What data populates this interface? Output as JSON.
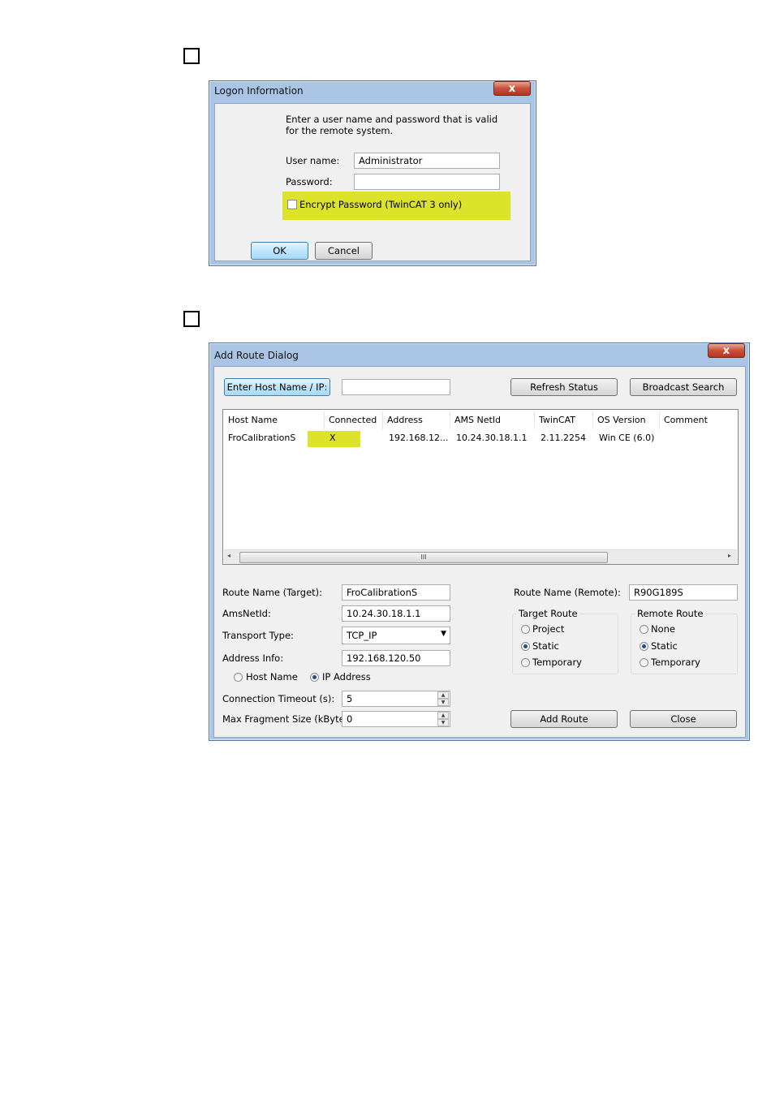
{
  "logon": {
    "title": "Logon Information",
    "close_glyph": "x",
    "instruction": "Enter a user name and password that is valid for the remote system.",
    "username_label": "User name:",
    "username_value": "Administrator",
    "password_label": "Password:",
    "password_value": "",
    "encrypt_label": "Encrypt Password (TwinCAT 3 only)",
    "ok_label": "OK",
    "cancel_label": "Cancel"
  },
  "route": {
    "title": "Add Route Dialog",
    "close_glyph": "x",
    "enter_host_label": "Enter Host Name / IP:",
    "host_input_value": "",
    "refresh_label": "Refresh Status",
    "broadcast_label": "Broadcast Search",
    "columns": [
      "Host Name",
      "Connected",
      "Address",
      "AMS NetId",
      "TwinCAT",
      "OS Version",
      "Comment"
    ],
    "rows": [
      [
        "FroCalibrationS",
        "X",
        "192.168.12...",
        "10.24.30.18.1.1",
        "2.11.2254",
        "Win CE (6.0)",
        ""
      ]
    ],
    "scroll_thumb_glyph": "III",
    "route_name_target_label": "Route Name (Target):",
    "route_name_target_value": "FroCalibrationS",
    "amsnetid_label": "AmsNetId:",
    "amsnetid_value": "10.24.30.18.1.1",
    "transport_label": "Transport Type:",
    "transport_value": "TCP_IP",
    "address_info_label": "Address Info:",
    "address_info_value": "192.168.120.50",
    "host_name_radio": "Host Name",
    "ip_address_radio": "IP Address",
    "timeout_label": "Connection Timeout (s):",
    "timeout_value": "5",
    "fragment_label": "Max Fragment Size (kByte):",
    "fragment_value": "0",
    "route_name_remote_label": "Route Name (Remote):",
    "route_name_remote_value": "R90G189S",
    "target_route": {
      "title": "Target Route",
      "options": [
        "Project",
        "Static",
        "Temporary"
      ],
      "selected": "Static"
    },
    "remote_route": {
      "title": "Remote Route",
      "options": [
        "None",
        "Static",
        "Temporary"
      ],
      "selected": "Static"
    },
    "add_route_label": "Add Route",
    "close_label": "Close"
  },
  "colors": {
    "highlight": "#dde22a",
    "window_frame": "#a9c4e4"
  }
}
